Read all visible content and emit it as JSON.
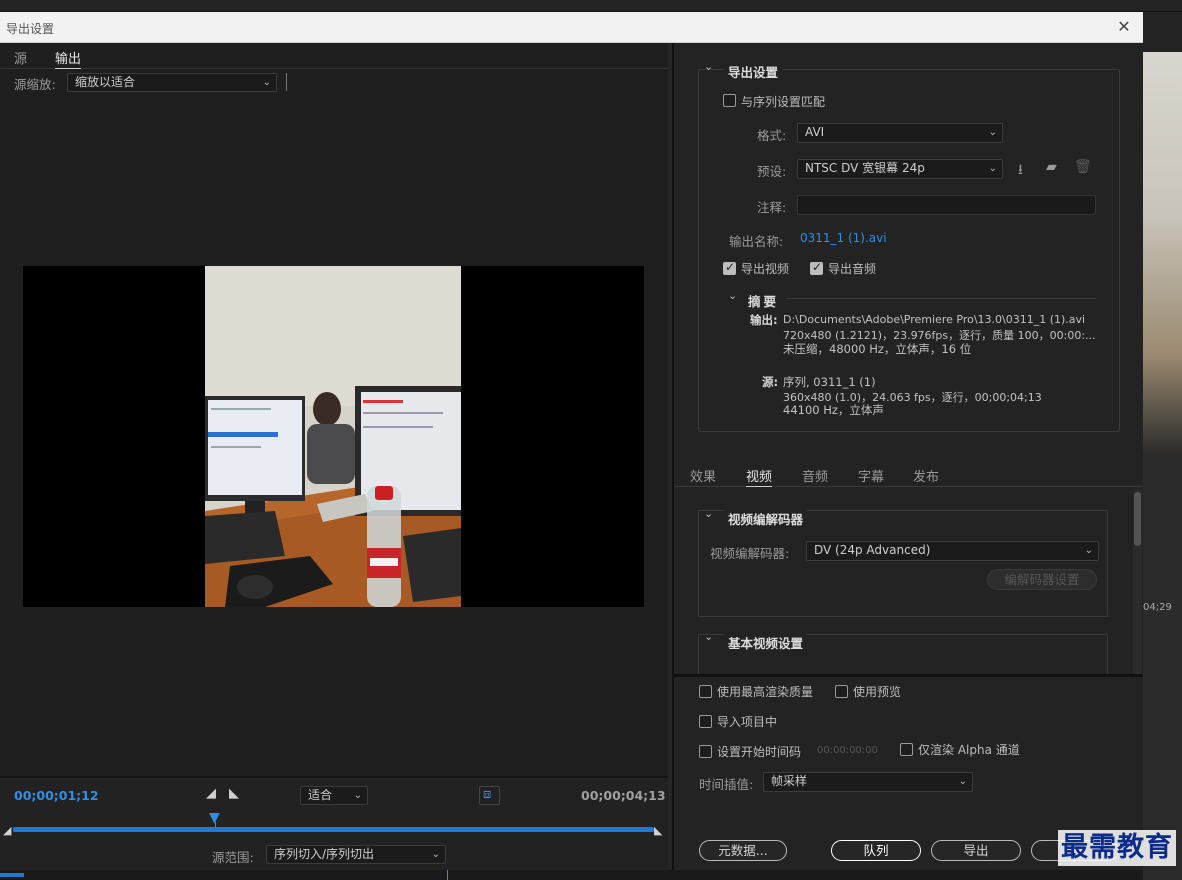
{
  "window": {
    "title": "导出设置"
  },
  "left": {
    "tabs": [
      "源",
      "输出"
    ],
    "active_tab": "输出",
    "scale_label": "源缩放:",
    "scale_value": "缩放以适合",
    "timecode_start": "00;00;01;12",
    "timecode_end": "00;00;04;13",
    "zoom_value": "适合",
    "range_label": "源范围:",
    "range_value": "序列切入/序列切出"
  },
  "export_settings": {
    "title": "导出设置",
    "match_sequence": "与序列设置匹配",
    "format_label": "格式:",
    "format_value": "AVI",
    "preset_label": "预设:",
    "preset_value": "NTSC DV 宽银幕 24p",
    "comment_label": "注释:",
    "output_name_label": "输出名称:",
    "output_name_value": "0311_1 (1).avi",
    "export_video": "导出视频",
    "export_audio": "导出音频",
    "summary_title": "摘要",
    "output_label": "输出:",
    "output_lines": [
      "D:\\Documents\\Adobe\\Premiere Pro\\13.0\\0311_1 (1).avi",
      "720x480 (1.2121)，23.976fps，逐行，质量 100，00:00:...",
      "未压缩，48000 Hz，立体声，16 位"
    ],
    "source_label": "源:",
    "source_lines": [
      "序列, 0311_1 (1)",
      "360x480 (1.0)，24.063 fps，逐行，00;00;04;13",
      "44100 Hz，立体声"
    ]
  },
  "settings_tabs": [
    "效果",
    "视频",
    "音频",
    "字幕",
    "发布"
  ],
  "active_settings_tab": "视频",
  "video": {
    "codec_section": "视频编解码器",
    "codec_label": "视频编解码器:",
    "codec_value": "DV (24p Advanced)",
    "codec_settings_btn": "编解码器设置",
    "basic_section": "基本视频设置"
  },
  "bottom": {
    "max_render_quality": "使用最高渲染质量",
    "use_previews": "使用预览",
    "import_into_project": "导入项目中",
    "set_start_timecode": "设置开始时间码",
    "start_timecode_value": "00:00:00:00",
    "render_alpha_only": "仅渲染 Alpha 通道",
    "time_interp_label": "时间插值:",
    "time_interp_value": "帧采样",
    "metadata_btn": "元数据...",
    "queue_btn": "队列",
    "export_btn": "导出",
    "cancel_btn": ""
  },
  "watermark": "最需教育",
  "background_app": {
    "timecode": "04;29"
  },
  "colors": {
    "accent": "#2f8ee6",
    "timeline_bar": "#1f7ad4",
    "panel": "#232323"
  }
}
